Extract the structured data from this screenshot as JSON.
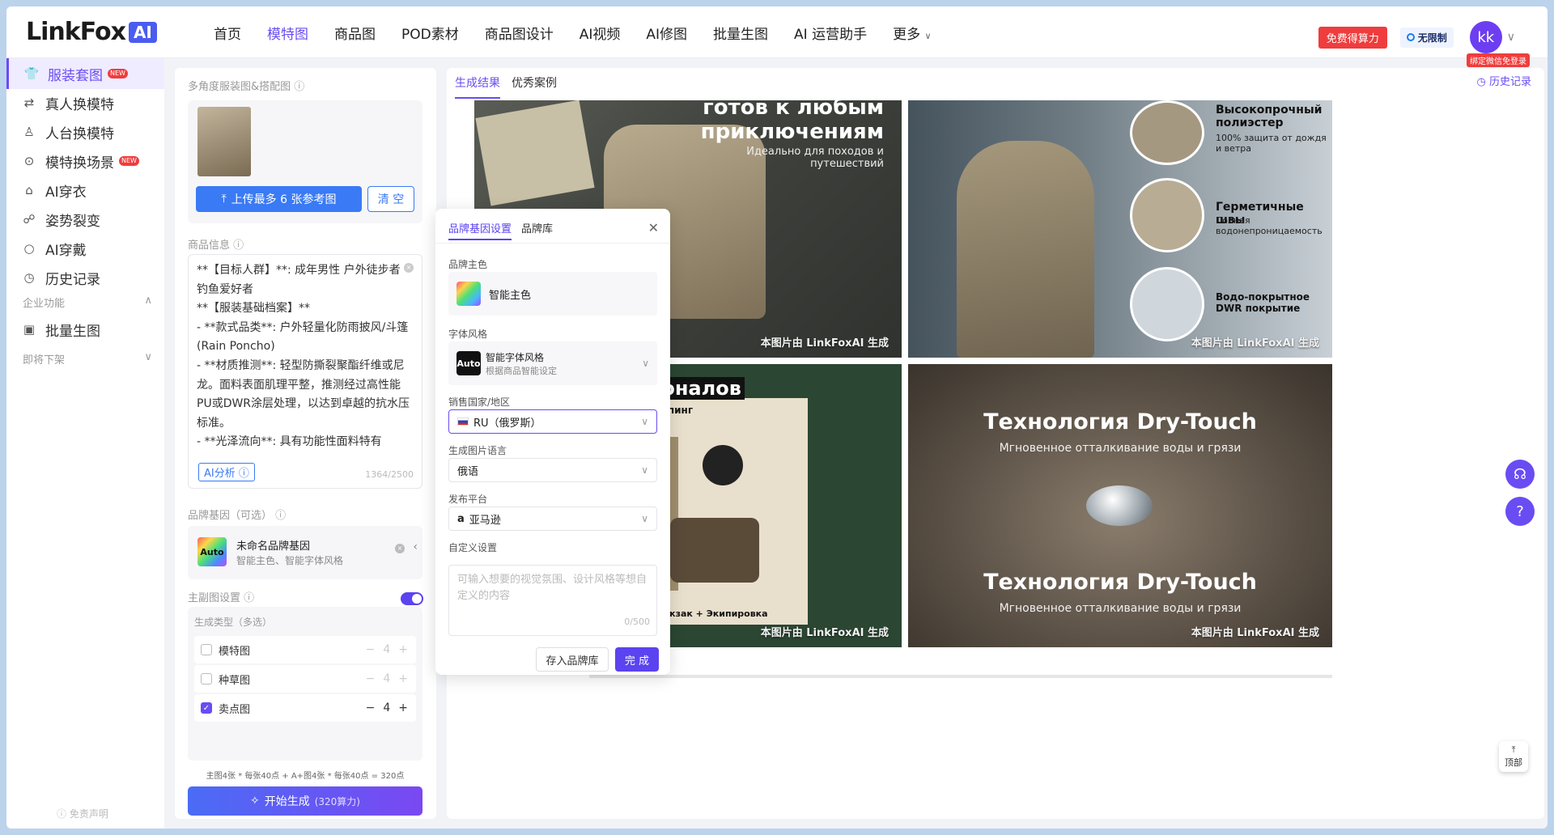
{
  "header": {
    "logo_text": "LinkFox",
    "logo_badge": "AI",
    "nav": [
      "首页",
      "模特图",
      "商品图",
      "POD素材",
      "商品图设计",
      "AI视频",
      "AI修图",
      "批量生图",
      "AI 运营助手",
      "更多"
    ],
    "active_nav": "模特图",
    "free_btn": "免费得算力",
    "unlimited": "无限制",
    "avatar": "kk",
    "bind_tag": "绑定微信免登录"
  },
  "sidebar": {
    "items": [
      {
        "label": "服装套图",
        "icon": "shirt-icon",
        "new": true,
        "active": true
      },
      {
        "label": "真人换模特",
        "icon": "person-swap-icon"
      },
      {
        "label": "人台换模特",
        "icon": "mannequin-icon"
      },
      {
        "label": "模特换场景",
        "icon": "scene-icon",
        "new": true
      },
      {
        "label": "AI穿衣",
        "icon": "hanger-icon"
      },
      {
        "label": "姿势裂变",
        "icon": "pose-icon"
      },
      {
        "label": "AI穿戴",
        "icon": "ring-icon"
      },
      {
        "label": "历史记录",
        "icon": "clock-icon"
      }
    ],
    "group_enterprise": "企业功能",
    "batch": "批量生图",
    "group_offline": "即将下架",
    "new_tag": "NEW",
    "disclaimer": "免责声明"
  },
  "config": {
    "ref_label": "多角度服装图&搭配图",
    "upload_btn": "上传最多 6 张参考图",
    "clear_btn": "清 空",
    "info_label": "商品信息",
    "info_text": "**【目标人群】**: 成年男性 户外徒步者 钓鱼爱好者\n**【服装基础档案】**\n- **款式品类**: 户外轻量化防雨披风/斗篷 (Rain Poncho)\n- **材质推测**: 轻型防撕裂聚酯纤维或尼龙。面料表面肌理平整，推测经过高性能PU或DWR涂层处理，以达到卓越的抗水压标准。\n- **光泽流向**: 具有功能性面料特有",
    "ai_btn": "AI分析",
    "counter": "1364/2500",
    "brand_label": "品牌基因（可选）",
    "brand_name": "未命名品牌基因",
    "brand_sub": "智能主色、智能字体风格",
    "main_label": "主副图设置",
    "gen_label": "生成类型（多选）",
    "gen_types": [
      {
        "label": "模特图",
        "checked": false,
        "count": "4"
      },
      {
        "label": "种草图",
        "checked": false,
        "count": "4"
      },
      {
        "label": "卖点图",
        "checked": true,
        "count": "4"
      }
    ],
    "formula": "主图4张 * 每张40点 + A+图4张 * 每张40点 = 320点",
    "start_btn": "开始生成",
    "start_sub": "(320算力)"
  },
  "results": {
    "tabs": [
      "生成结果",
      "优秀案例"
    ],
    "history": "历史记录",
    "watermark": "本图片由 LinkFoxAI 生成",
    "tile1_title": "готов к любым приключениям",
    "tile1_sub": "Идеально для походов и путешествий",
    "tile2_f1_title": "Высокопрочный полиэстер",
    "tile2_f1_sub": "100% защита от дождя и ветра",
    "tile2_f2_title": "Герметичные швы",
    "tile2_f2_sub": "Полная водонепроницаемость",
    "tile2_f3_title": "Водо-покрытное DWR покрытие",
    "tile3_title": "фессионалов",
    "tile3_sub": "ыбалка / Кемпинг",
    "tile3_caption": "Пончо + Рюкзак + Экипировка",
    "tile4_title1": "Технология Dry-Touch",
    "tile4_sub1": "Мгновенное отталкивание воды и грязи",
    "tile4_title2": "Технология Dry-Touch",
    "tile4_sub2": "Мгновенное отталкивание воды и грязи"
  },
  "modal": {
    "tabs": [
      "品牌基因设置",
      "品牌库"
    ],
    "color_label": "品牌主色",
    "color_value": "智能主色",
    "font_label": "字体风格",
    "font_auto": "Auto",
    "font_value": "智能字体风格",
    "font_sub": "根据商品智能设定",
    "country_label": "销售国家/地区",
    "country_value": "RU（俄罗斯）",
    "lang_label": "生成图片语言",
    "lang_value": "俄语",
    "platform_label": "发布平台",
    "platform_value": "亚马逊",
    "custom_label": "自定义设置",
    "custom_placeholder": "可输入想要的视觉氛围、设计风格等想自定义的内容",
    "custom_count": "0/500",
    "save_btn": "存入品牌库",
    "done_btn": "完 成"
  },
  "floating": {
    "top_label": "顶部"
  }
}
